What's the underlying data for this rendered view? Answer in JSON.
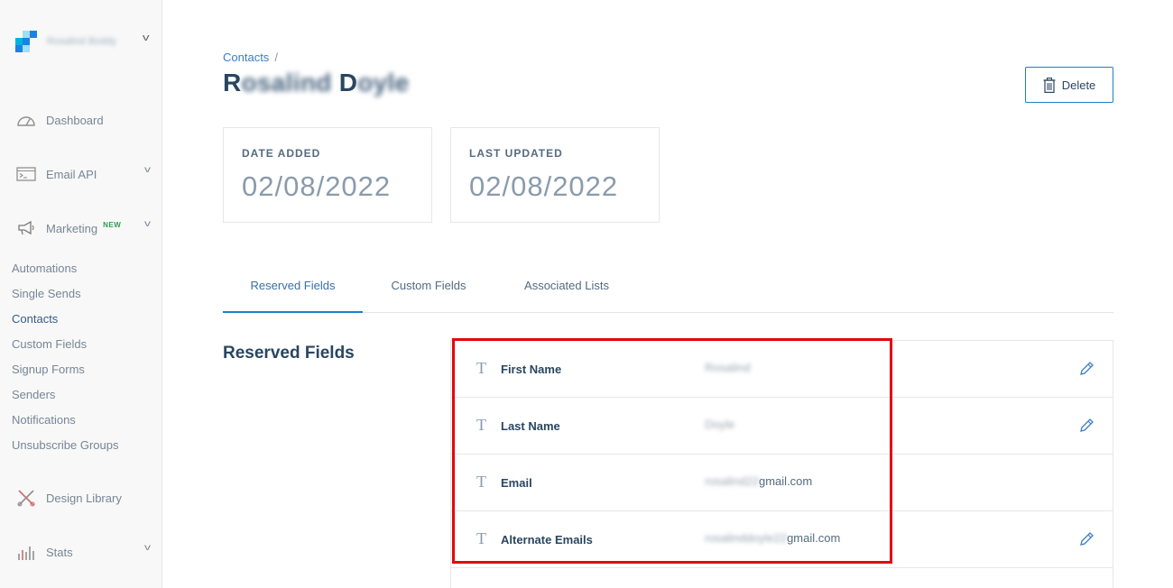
{
  "account": {
    "name": "Rosalind Boddy"
  },
  "sidebar": {
    "main": [
      {
        "label": "Dashboard",
        "icon": "gauge-icon"
      },
      {
        "label": "Email API",
        "icon": "terminal-icon"
      },
      {
        "label": "Marketing",
        "icon": "megaphone-icon",
        "badge": "NEW"
      },
      {
        "label": "Design Library",
        "icon": "design-tools-icon"
      },
      {
        "label": "Stats",
        "icon": "bar-chart-icon"
      }
    ],
    "marketing_items": [
      "Automations",
      "Single Sends",
      "Contacts",
      "Custom Fields",
      "Signup Forms",
      "Senders",
      "Notifications",
      "Unsubscribe Groups"
    ],
    "active_item": "Contacts"
  },
  "breadcrumb": {
    "link": "Contacts",
    "separator": "/"
  },
  "contact": {
    "first_initial": "R",
    "first_rest": "osalind",
    "last_initial": "D",
    "last_rest": "oyle"
  },
  "actions": {
    "delete_label": "Delete"
  },
  "stats": {
    "date_added_label": "DATE ADDED",
    "date_added": "02/08/2022",
    "last_updated_label": "LAST UPDATED",
    "last_updated": "02/08/2022"
  },
  "tabs": [
    "Reserved Fields",
    "Custom Fields",
    "Associated Lists"
  ],
  "section_title": "Reserved Fields",
  "fields": [
    {
      "name": "First Name",
      "value_blurred": "Rosalind",
      "value_visible": ""
    },
    {
      "name": "Last Name",
      "value_blurred": "Doyle",
      "value_visible": ""
    },
    {
      "name": "Email",
      "value_blurred": "rosalind22",
      "value_visible": "gmail.com"
    },
    {
      "name": "Alternate Emails",
      "value_blurred": "rosalinddoyle22",
      "value_visible": "gmail.com"
    }
  ],
  "colors": {
    "accent": "#1a82c7",
    "title": "#294661",
    "highlight": "#e30613",
    "new_badge": "#2a9d55"
  }
}
